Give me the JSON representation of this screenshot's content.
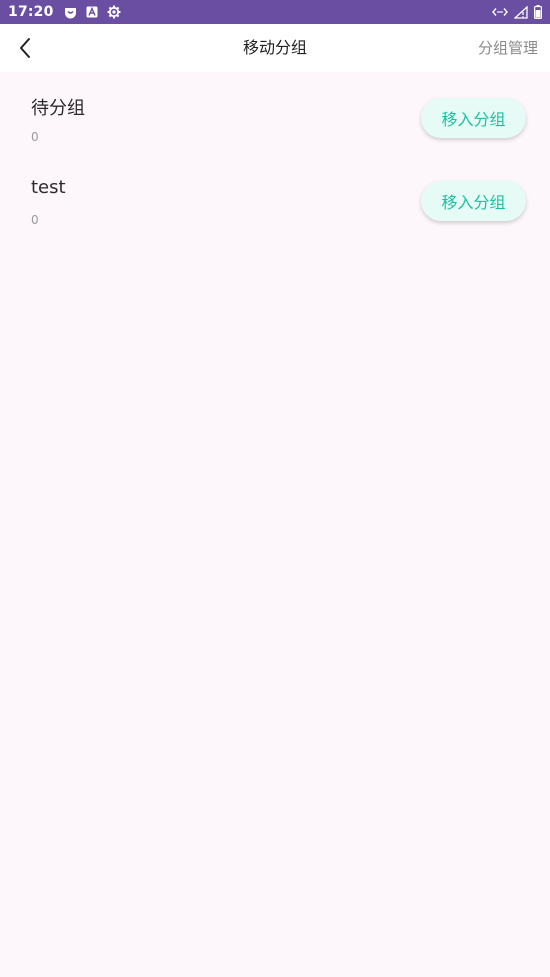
{
  "status_bar": {
    "time": "17:20",
    "background": "#6a4ea2",
    "left_icons": [
      "notification-badge-icon",
      "app-a-icon",
      "settings-gear-icon"
    ],
    "right_icons": [
      "data-transfer-icon",
      "signal-icon",
      "battery-icon"
    ]
  },
  "header": {
    "title": "移动分组",
    "manage_label": "分组管理"
  },
  "groups": [
    {
      "name": "待分组",
      "count": "0",
      "button_label": "移入分组"
    },
    {
      "name": "test",
      "count": "0",
      "button_label": "移入分组"
    }
  ],
  "colors": {
    "page_background": "#fdf7fc",
    "button_background": "#e6fbf6",
    "button_text": "#1fbfa0"
  }
}
